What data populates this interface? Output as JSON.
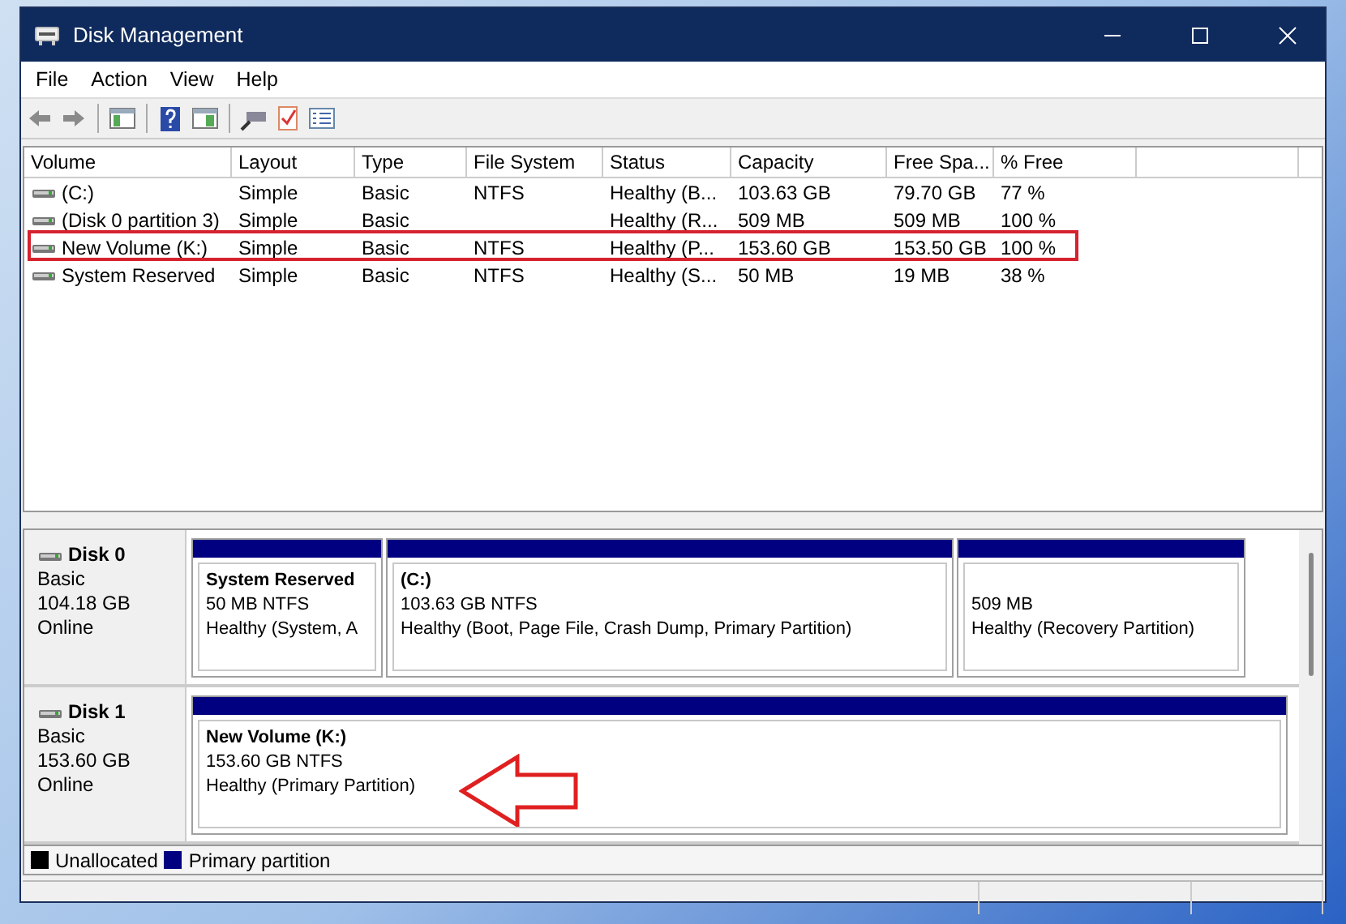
{
  "window": {
    "title": "Disk Management"
  },
  "menu": [
    "File",
    "Action",
    "View",
    "Help"
  ],
  "volumes": {
    "columns": [
      "Volume",
      "Layout",
      "Type",
      "File System",
      "Status",
      "Capacity",
      "Free Spa...",
      "% Free"
    ],
    "rows": [
      {
        "cells": [
          " (C:)",
          "Simple",
          "Basic",
          "NTFS",
          "Healthy (B...",
          "103.63 GB",
          "79.70 GB",
          "77 %"
        ],
        "highlighted": false
      },
      {
        "cells": [
          "(Disk 0 partition 3)",
          "Simple",
          "Basic",
          "",
          "Healthy (R...",
          "509 MB",
          "509 MB",
          "100 %"
        ],
        "highlighted": false
      },
      {
        "cells": [
          "New Volume (K:)",
          "Simple",
          "Basic",
          "NTFS",
          "Healthy (P...",
          "153.60 GB",
          "153.50 GB",
          "100 %"
        ],
        "highlighted": true
      },
      {
        "cells": [
          "System Reserved",
          "Simple",
          "Basic",
          "NTFS",
          "Healthy (S...",
          "50 MB",
          "19 MB",
          "38 %"
        ],
        "highlighted": false
      }
    ]
  },
  "disks": [
    {
      "name": "Disk 0",
      "type": "Basic",
      "size": "104.18 GB",
      "status": "Online",
      "partitions": [
        {
          "name": "System Reserved",
          "size": "50 MB NTFS",
          "status": "Healthy (System, A",
          "pointed": false
        },
        {
          "name": " (C:)",
          "size": "103.63 GB NTFS",
          "status": "Healthy (Boot, Page File, Crash Dump, Primary Partition)",
          "pointed": false
        },
        {
          "size": "509 MB",
          "status": "Healthy (Recovery Partition)",
          "pointed": false
        }
      ]
    },
    {
      "name": "Disk 1",
      "type": "Basic",
      "size": "153.60 GB",
      "status": "Online",
      "partitions": [
        {
          "name": "New Volume  (K:)",
          "size": "153.60 GB NTFS",
          "status": "Healthy (Primary Partition)",
          "pointed": true
        }
      ]
    }
  ],
  "legend": [
    {
      "label": "Unallocated",
      "color": "#000000"
    },
    {
      "label": "Primary partition",
      "color": "#000080"
    }
  ]
}
